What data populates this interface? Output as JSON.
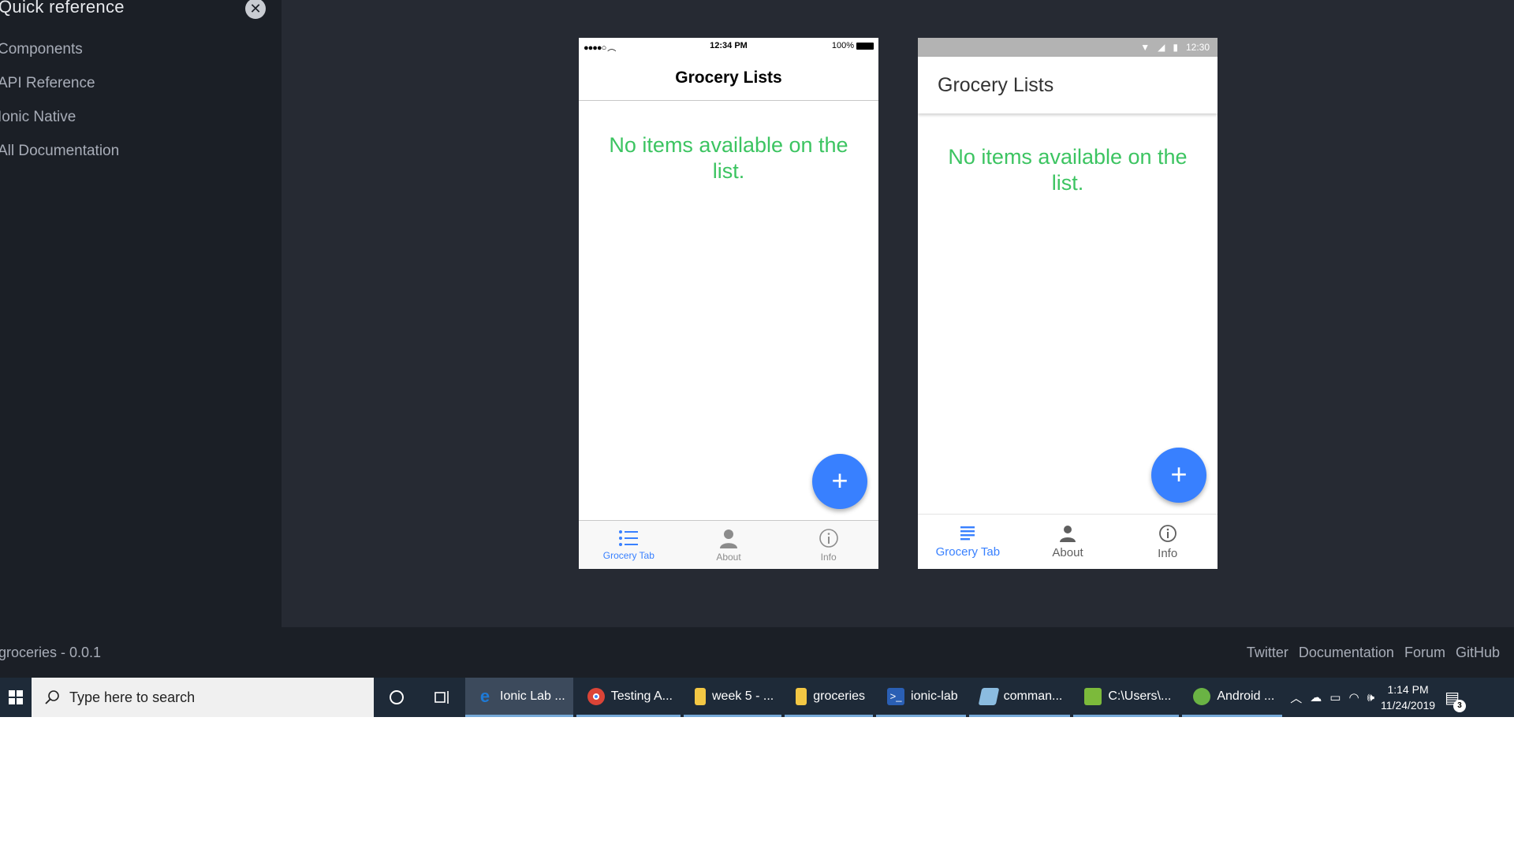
{
  "sidebar": {
    "title": "Quick reference",
    "items": [
      {
        "label": "Components"
      },
      {
        "label": "API Reference"
      },
      {
        "label": "Ionic Native"
      },
      {
        "label": "All Documentation"
      }
    ]
  },
  "footer": {
    "version": "groceries - 0.0.1",
    "links": [
      "Twitter",
      "Documentation",
      "Forum",
      "GitHub"
    ]
  },
  "ios": {
    "status_time": "12:34 PM",
    "battery": "100%",
    "header_title": "Grocery Lists",
    "empty_message": "No items available on the list.",
    "fab": "+",
    "tabs": [
      {
        "label": "Grocery Tab",
        "icon": "list-icon",
        "active": true
      },
      {
        "label": "About",
        "icon": "person-icon",
        "active": false
      },
      {
        "label": "Info",
        "icon": "info-icon",
        "active": false
      }
    ]
  },
  "android": {
    "status_time": "12:30",
    "header_title": "Grocery Lists",
    "empty_message": "No items available on the list.",
    "fab": "+",
    "tabs": [
      {
        "label": "Grocery Tab",
        "icon": "list-icon",
        "active": true
      },
      {
        "label": "About",
        "icon": "person-icon",
        "active": false
      },
      {
        "label": "Info",
        "icon": "info-icon",
        "active": false
      }
    ]
  },
  "taskbar": {
    "search_placeholder": "Type here to search",
    "tasks": [
      {
        "label": "Ionic Lab ...",
        "icon": "edge-icon",
        "color": "#1e7ad6"
      },
      {
        "label": "Testing A...",
        "icon": "chrome-icon",
        "color": "#db4437"
      },
      {
        "label": "week 5 - ...",
        "icon": "folder-icon",
        "color": "#f3c744"
      },
      {
        "label": "groceries",
        "icon": "folder-icon",
        "color": "#f3c744"
      },
      {
        "label": "ionic-lab",
        "icon": "powershell-icon",
        "color": "#2a5fb4"
      },
      {
        "label": "comman...",
        "icon": "notepad-icon",
        "color": "#8bbce0"
      },
      {
        "label": "C:\\Users\\...",
        "icon": "notepadpp-icon",
        "color": "#7cba3b"
      },
      {
        "label": "Android ...",
        "icon": "android-studio-icon",
        "color": "#6ab344"
      }
    ],
    "clock_time": "1:14 PM",
    "clock_date": "11/24/2019",
    "notifications": "3"
  },
  "colors": {
    "accent": "#3880ff",
    "empty_text": "#3cc461",
    "sidebar_bg": "#1b1f26",
    "app_bg": "#262a33"
  }
}
